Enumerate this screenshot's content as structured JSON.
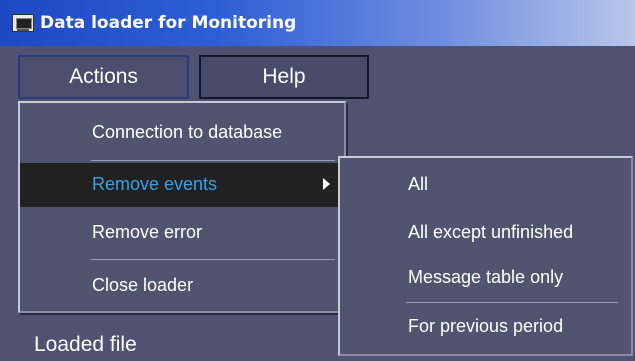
{
  "window": {
    "title": "Data loader for Monitoring",
    "icon": "monitor-app-icon"
  },
  "menubar": {
    "actions_label": "Actions",
    "help_label": "Help"
  },
  "actions_menu": {
    "connection_label": "Connection to database",
    "remove_events_label": "Remove events",
    "remove_error_label": "Remove error",
    "close_loader_label": "Close loader"
  },
  "remove_events_submenu": {
    "all_label": "All",
    "all_except_label": "All except unfinished",
    "message_table_label": "Message table only",
    "previous_period_label": "For previous period"
  },
  "main": {
    "loaded_file_label": "Loaded file"
  },
  "colors": {
    "title_bar_start": "#1d49c2",
    "highlight_text": "#39a0e8",
    "menu_bg": "#51546f"
  }
}
